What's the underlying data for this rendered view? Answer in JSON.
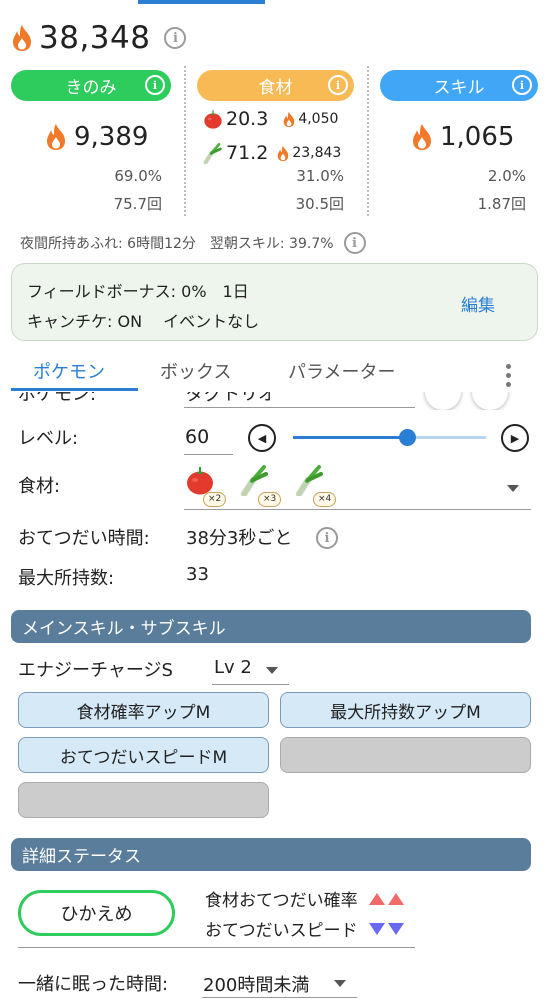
{
  "summary": {
    "total_strength": "38,348"
  },
  "berry": {
    "label": "きのみ",
    "strength": "9,389",
    "ratio": "69.0%",
    "count": "75.7回"
  },
  "ingredient": {
    "label": "食材",
    "items": [
      {
        "icon": "tomato-icon",
        "amount": "20.3",
        "strength": "4,050"
      },
      {
        "icon": "leek-icon",
        "amount": "71.2",
        "strength": "23,843"
      }
    ],
    "ratio": "31.0%",
    "count": "30.5回"
  },
  "skill": {
    "label": "スキル",
    "strength": "1,065",
    "ratio": "2.0%",
    "count": "1.87回"
  },
  "note": "夜間所持あふれ: 6時間12分　翌朝スキル: 39.7%",
  "bonus": {
    "line1": "フィールドボーナス: 0%　1日",
    "line2": "キャンチケ: ON　 イベントなし",
    "edit_label": "編集"
  },
  "tabs": {
    "pokemon": "ポケモン",
    "box": "ボックス",
    "parameter": "パラメーター"
  },
  "form": {
    "pokemon_label": "ポケモン:",
    "pokemon_value": "ダグトリオ",
    "level_label": "レベル:",
    "level_value": "60",
    "level_fraction": 0.59,
    "ingredient_label": "食材:",
    "ingredients": [
      {
        "icon": "tomato-icon",
        "count": "×2"
      },
      {
        "icon": "leek-icon",
        "count": "×3"
      },
      {
        "icon": "leek-icon",
        "count": "×4"
      }
    ],
    "help_time_label": "おてつだい時間:",
    "help_time_value": "38分3秒ごと",
    "max_carry_label": "最大所持数:",
    "max_carry_value": "33"
  },
  "skills_section": {
    "title": "メインスキル・サブスキル",
    "main_skill": "エナジーチャージS",
    "main_skill_level": "Lv 2",
    "sub_skills": [
      "食材確率アップM",
      "最大所持数アップM",
      "おてつだいスピードM",
      "",
      ""
    ]
  },
  "detail_section": {
    "title": "詳細ステータス",
    "nature": "ひかえめ",
    "up_effect": "食材おてつだい確率",
    "down_effect": "おてつだいスピード",
    "sleep_label": "一緒に眠った時間:",
    "sleep_value": "200時間未満"
  },
  "colors": {
    "accent": "#2a7fd4",
    "berry": "#2ecc5c",
    "ingredient": "#f7ba55",
    "skill": "#40a6f5",
    "section": "#5a7d9b"
  }
}
